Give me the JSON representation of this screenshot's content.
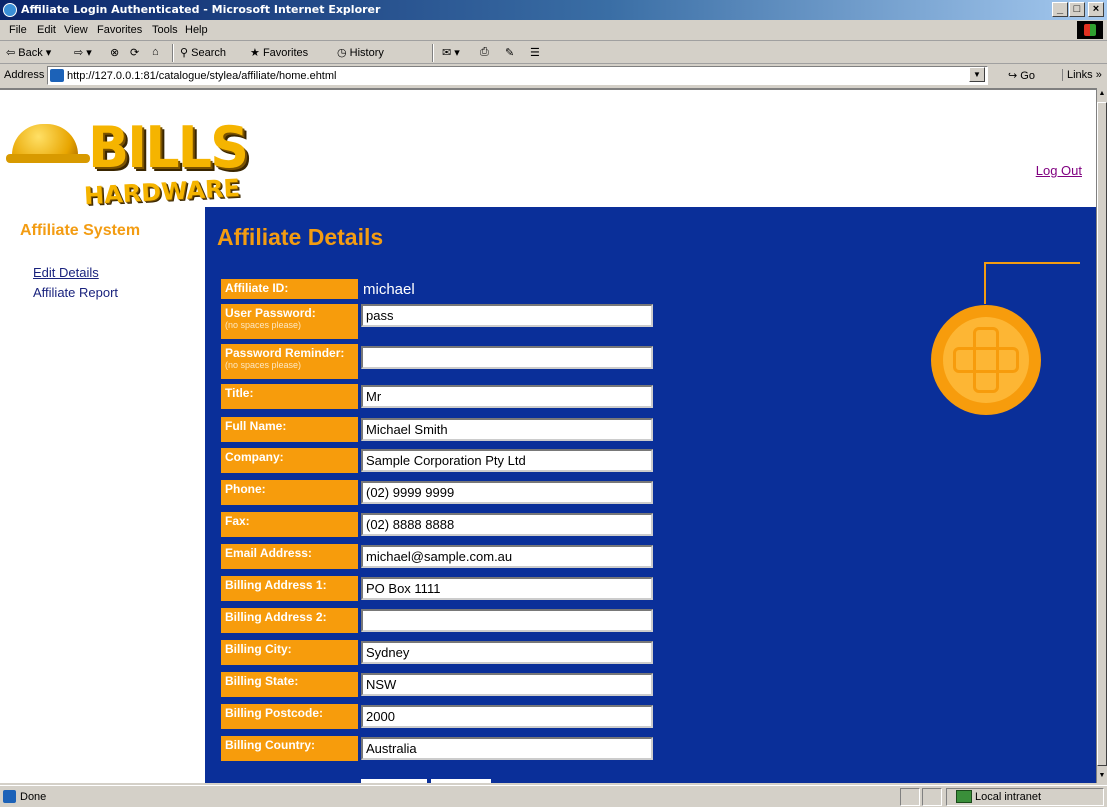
{
  "window": {
    "title": "Affiliate Login Authenticated - Microsoft Internet Explorer",
    "controls": [
      "_",
      "□",
      "×"
    ]
  },
  "menu": [
    "File",
    "Edit",
    "View",
    "Favorites",
    "Tools",
    "Help"
  ],
  "toolbar": {
    "back": "Back",
    "search": "Search",
    "favorites": "Favorites",
    "history": "History"
  },
  "address": {
    "label": "Address",
    "url": "http://127.0.0.1:81/catalogue/stylea/affiliate/home.ehtml",
    "go": "Go",
    "links": "Links"
  },
  "header": {
    "logo_top": "BILLS",
    "logo_bottom": "HARDWARE",
    "logout": "Log Out"
  },
  "sidebar": {
    "title": "Affiliate System",
    "items": [
      {
        "label": "Edit Details"
      },
      {
        "label": "Affiliate Report"
      }
    ]
  },
  "main": {
    "title": "Affiliate Details",
    "affiliate_id_label": "Affiliate ID:",
    "affiliate_id_value": "michael",
    "no_spaces_note": "(no spaces please)",
    "fields": [
      {
        "label": "User Password:",
        "value": "pass"
      },
      {
        "label": "Password Reminder:",
        "value": ""
      },
      {
        "label": "Title:",
        "value": "Mr"
      },
      {
        "label": "Full Name:",
        "value": "Michael Smith"
      },
      {
        "label": "Company:",
        "value": "Sample Corporation Pty Ltd"
      },
      {
        "label": "Phone:",
        "value": "(02) 9999 9999"
      },
      {
        "label": "Fax:",
        "value": "(02) 8888 8888"
      },
      {
        "label": "Email Address:",
        "value": "michael@sample.com.au"
      },
      {
        "label": "Billing Address 1:",
        "value": "PO Box 1111"
      },
      {
        "label": "Billing Address 2:",
        "value": ""
      },
      {
        "label": "Billing City:",
        "value": "Sydney"
      },
      {
        "label": "Billing State:",
        "value": "NSW"
      },
      {
        "label": "Billing Postcode:",
        "value": "2000"
      },
      {
        "label": "Billing Country:",
        "value": "Australia"
      }
    ]
  },
  "status": {
    "text": "Done",
    "zone": "Local intranet"
  },
  "colors": {
    "accent": "#f79c0c",
    "main_bg": "#0a2f99",
    "link": "#1a237e",
    "visited": "#800080"
  }
}
